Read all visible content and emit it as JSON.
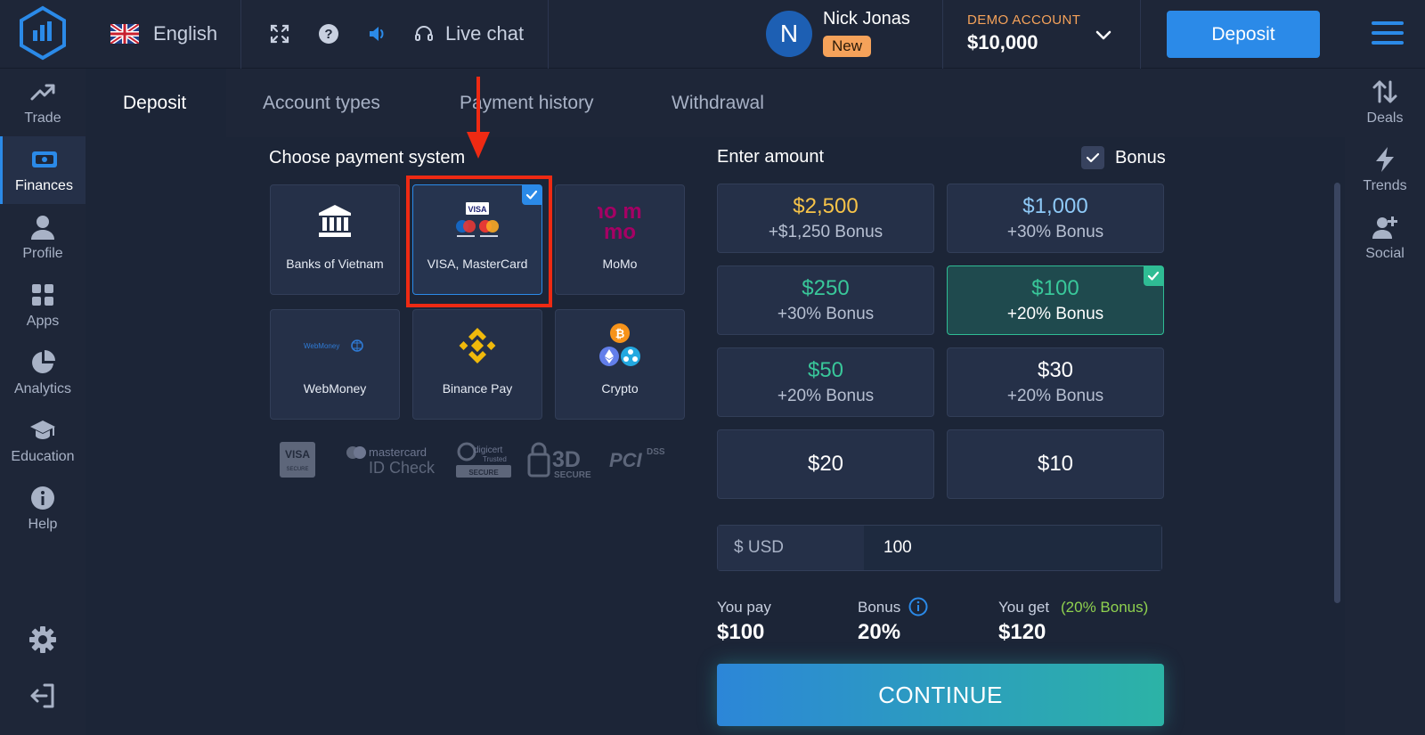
{
  "header": {
    "language": "English",
    "live_chat": "Live chat",
    "user_initial": "N",
    "user_name": "Nick Jonas",
    "user_badge": "New",
    "account_type": "DEMO ACCOUNT",
    "account_balance": "$10,000",
    "deposit_button": "Deposit",
    "icons": [
      "logo-icon",
      "uk-flag-icon",
      "fullscreen-icon",
      "help-icon",
      "sound-icon",
      "headset-icon",
      "chevron-down-icon",
      "hamburger-menu-icon"
    ]
  },
  "left_nav": [
    {
      "label": "Trade",
      "icon": "trend-up-icon"
    },
    {
      "label": "Finances",
      "icon": "banknote-icon",
      "active": true
    },
    {
      "label": "Profile",
      "icon": "person-icon"
    },
    {
      "label": "Apps",
      "icon": "apps-grid-icon"
    },
    {
      "label": "Analytics",
      "icon": "pie-chart-icon"
    },
    {
      "label": "Education",
      "icon": "graduation-cap-icon"
    },
    {
      "label": "Help",
      "icon": "info-icon"
    }
  ],
  "left_nav_bottom": [
    "settings-gear-icon",
    "logout-icon"
  ],
  "right_nav": [
    {
      "label": "Deals",
      "icon": "up-down-arrows-icon"
    },
    {
      "label": "Trends",
      "icon": "lightning-icon"
    },
    {
      "label": "Social",
      "icon": "add-user-icon"
    }
  ],
  "tabs": [
    {
      "label": "Deposit",
      "active": true
    },
    {
      "label": "Account types"
    },
    {
      "label": "Payment history"
    },
    {
      "label": "Withdrawal"
    }
  ],
  "payment": {
    "title": "Choose payment system",
    "systems": [
      {
        "label": "Banks of Vietnam",
        "icon": "bank-icon"
      },
      {
        "label": "VISA, MasterCard",
        "icon": "visa-mastercard-icon",
        "selected": true
      },
      {
        "label": "MoMo",
        "icon": "momo-logo-icon",
        "logo_text": "mo mo"
      },
      {
        "label": "WebMoney",
        "icon": "webmoney-logo-icon",
        "logo_text": "WebMoney"
      },
      {
        "label": "Binance Pay",
        "icon": "binance-icon"
      },
      {
        "label": "Crypto",
        "icon": "crypto-coins-icon"
      }
    ],
    "trust_badges": {
      "visa_secure": [
        "VISA",
        "SECURE"
      ],
      "mastercard": [
        "mastercard",
        "ID Check"
      ],
      "digicert": [
        "digicert",
        "Trusted",
        "SECURE"
      ],
      "threed": [
        "3D",
        "SECURE"
      ],
      "pci": [
        "PCI",
        "DSS"
      ]
    }
  },
  "amount": {
    "title": "Enter amount",
    "bonus_label": "Bonus",
    "bonus_checked": true,
    "options": [
      {
        "value": "$2,500",
        "bonus": "+$1,250 Bonus",
        "color": "#f7c348"
      },
      {
        "value": "$1,000",
        "bonus": "+30% Bonus",
        "color": "#8ec9f7"
      },
      {
        "value": "$250",
        "bonus": "+30% Bonus",
        "color": "#39c79a"
      },
      {
        "value": "$100",
        "bonus": "+20% Bonus",
        "color": "#39c79a",
        "selected": true
      },
      {
        "value": "$50",
        "bonus": "+20% Bonus",
        "color": "#39c79a"
      },
      {
        "value": "$30",
        "bonus": "+20% Bonus",
        "color": "#ffffff"
      },
      {
        "value": "$20",
        "bonus": "",
        "color": "#ffffff"
      },
      {
        "value": "$10",
        "bonus": "",
        "color": "#ffffff"
      }
    ],
    "currency_label": "$ USD",
    "input_value": "100"
  },
  "summary": {
    "you_pay_label": "You pay",
    "you_pay_value": "$100",
    "bonus_label": "Bonus",
    "bonus_value": "20%",
    "you_get_label": "You get",
    "you_get_note": "(20% Bonus)",
    "you_get_value": "$120"
  },
  "continue_button": "CONTINUE",
  "colors": {
    "accent_blue": "#2b8ae8",
    "accent_green": "#2fbc94",
    "highlight_red": "#ee2a13",
    "demo_orange": "#f5a25a",
    "bonus_note_green": "#8fd14f"
  }
}
